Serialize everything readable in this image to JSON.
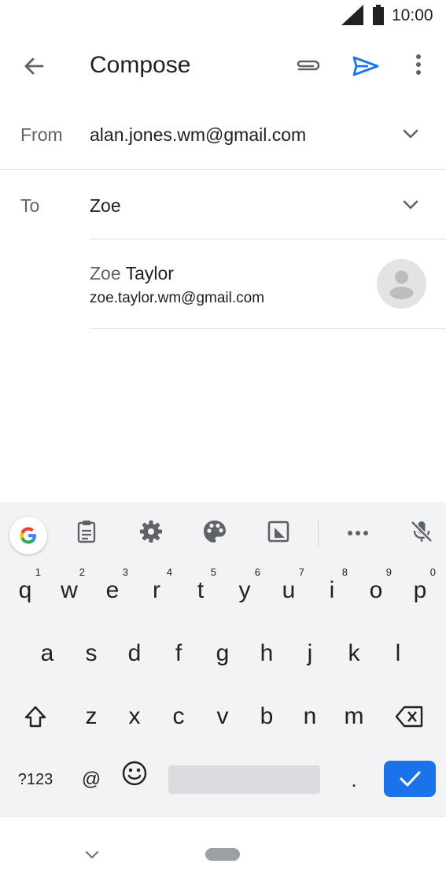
{
  "status_bar": {
    "time": "10:00"
  },
  "app_bar": {
    "title": "Compose"
  },
  "from": {
    "label": "From",
    "value": "alan.jones.wm@gmail.com"
  },
  "to": {
    "label": "To",
    "value": "Zoe"
  },
  "suggestion": {
    "name_match": "Zoe",
    "name_rest": " Taylor",
    "email": "zoe.taylor.wm@gmail.com"
  },
  "keyboard": {
    "row1": [
      {
        "key": "q",
        "hint": "1"
      },
      {
        "key": "w",
        "hint": "2"
      },
      {
        "key": "e",
        "hint": "3"
      },
      {
        "key": "r",
        "hint": "4"
      },
      {
        "key": "t",
        "hint": "5"
      },
      {
        "key": "y",
        "hint": "6"
      },
      {
        "key": "u",
        "hint": "7"
      },
      {
        "key": "i",
        "hint": "8"
      },
      {
        "key": "o",
        "hint": "9"
      },
      {
        "key": "p",
        "hint": "0"
      }
    ],
    "row2": [
      "a",
      "s",
      "d",
      "f",
      "g",
      "h",
      "j",
      "k",
      "l"
    ],
    "row3": [
      "z",
      "x",
      "c",
      "v",
      "b",
      "n",
      "m"
    ],
    "row4": {
      "symbols": "?123",
      "at": "@",
      "period": "."
    }
  },
  "colors": {
    "accent": "#1a73e8",
    "keyboard_bg": "#f1f3f4",
    "divider": "#e0e0e0"
  }
}
